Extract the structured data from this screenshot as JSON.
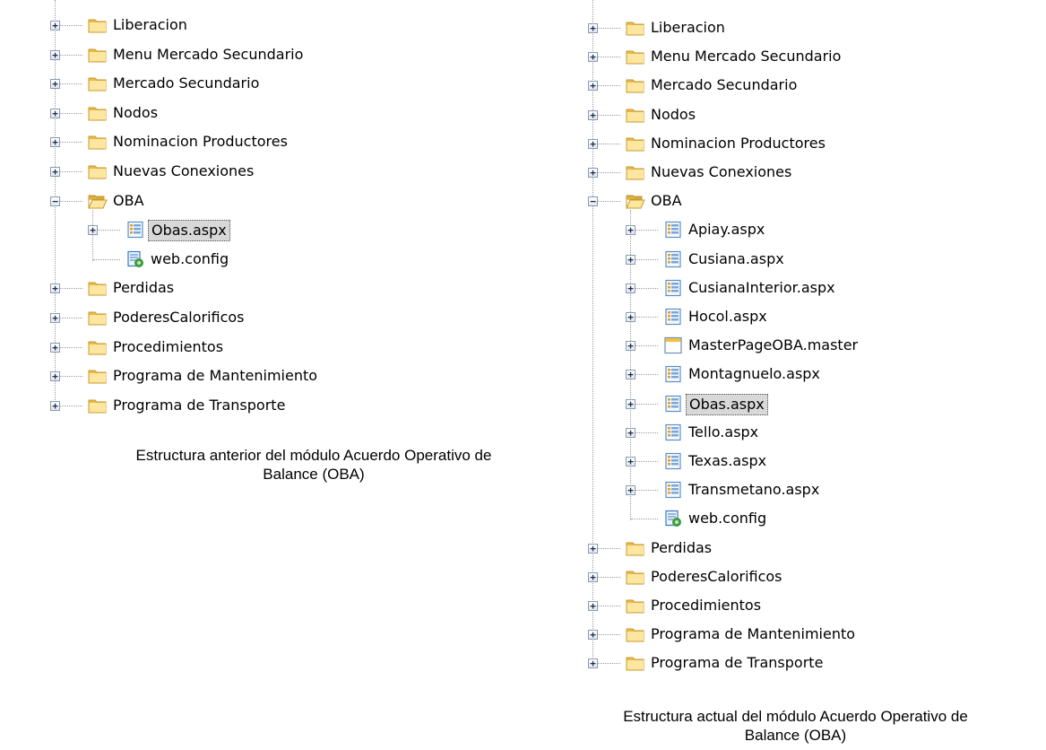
{
  "left_tree": {
    "nodes": [
      {
        "label": "Liberacion",
        "type": "folder",
        "expand": "+",
        "depth": 0
      },
      {
        "label": "Menu Mercado Secundario",
        "type": "folder",
        "expand": "+",
        "depth": 0
      },
      {
        "label": "Mercado Secundario",
        "type": "folder",
        "expand": "+",
        "depth": 0
      },
      {
        "label": "Nodos",
        "type": "folder",
        "expand": "+",
        "depth": 0
      },
      {
        "label": "Nominacion Productores",
        "type": "folder",
        "expand": "+",
        "depth": 0
      },
      {
        "label": "Nuevas Conexiones",
        "type": "folder",
        "expand": "+",
        "depth": 0
      },
      {
        "label": "OBA",
        "type": "folder-open",
        "expand": "-",
        "depth": 0
      },
      {
        "label": "Obas.aspx",
        "type": "aspx",
        "expand": "+",
        "depth": 1,
        "selected": true
      },
      {
        "label": "web.config",
        "type": "config",
        "expand": "",
        "depth": 1
      },
      {
        "label": "Perdidas",
        "type": "folder",
        "expand": "+",
        "depth": 0
      },
      {
        "label": "PoderesCalorificos",
        "type": "folder",
        "expand": "+",
        "depth": 0
      },
      {
        "label": "Procedimientos",
        "type": "folder",
        "expand": "+",
        "depth": 0
      },
      {
        "label": "Programa de Mantenimiento",
        "type": "folder",
        "expand": "+",
        "depth": 0
      },
      {
        "label": "Programa de Transporte",
        "type": "folder",
        "expand": "+",
        "depth": 0
      }
    ],
    "caption_line1": "Estructura anterior del módulo Acuerdo Operativo de",
    "caption_line2": "Balance (OBA)"
  },
  "right_tree": {
    "nodes": [
      {
        "label": "Liberacion",
        "type": "folder",
        "expand": "+",
        "depth": 0
      },
      {
        "label": "Menu Mercado Secundario",
        "type": "folder",
        "expand": "+",
        "depth": 0
      },
      {
        "label": "Mercado Secundario",
        "type": "folder",
        "expand": "+",
        "depth": 0
      },
      {
        "label": "Nodos",
        "type": "folder",
        "expand": "+",
        "depth": 0
      },
      {
        "label": "Nominacion Productores",
        "type": "folder",
        "expand": "+",
        "depth": 0
      },
      {
        "label": "Nuevas Conexiones",
        "type": "folder",
        "expand": "+",
        "depth": 0
      },
      {
        "label": "OBA",
        "type": "folder-open",
        "expand": "-",
        "depth": 0
      },
      {
        "label": "Apiay.aspx",
        "type": "aspx",
        "expand": "+",
        "depth": 1
      },
      {
        "label": "Cusiana.aspx",
        "type": "aspx",
        "expand": "+",
        "depth": 1
      },
      {
        "label": "CusianaInterior.aspx",
        "type": "aspx",
        "expand": "+",
        "depth": 1
      },
      {
        "label": "Hocol.aspx",
        "type": "aspx",
        "expand": "+",
        "depth": 1
      },
      {
        "label": "MasterPageOBA.master",
        "type": "master",
        "expand": "+",
        "depth": 1
      },
      {
        "label": "Montagnuelo.aspx",
        "type": "aspx",
        "expand": "+",
        "depth": 1
      },
      {
        "label": "Obas.aspx",
        "type": "aspx",
        "expand": "+",
        "depth": 1,
        "selected": true
      },
      {
        "label": "Tello.aspx",
        "type": "aspx",
        "expand": "+",
        "depth": 1
      },
      {
        "label": "Texas.aspx",
        "type": "aspx",
        "expand": "+",
        "depth": 1
      },
      {
        "label": "Transmetano.aspx",
        "type": "aspx",
        "expand": "+",
        "depth": 1
      },
      {
        "label": "web.config",
        "type": "config",
        "expand": "",
        "depth": 1
      },
      {
        "label": "Perdidas",
        "type": "folder",
        "expand": "+",
        "depth": 0
      },
      {
        "label": "PoderesCalorificos",
        "type": "folder",
        "expand": "+",
        "depth": 0
      },
      {
        "label": "Procedimientos",
        "type": "folder",
        "expand": "+",
        "depth": 0
      },
      {
        "label": "Programa de Mantenimiento",
        "type": "folder",
        "expand": "+",
        "depth": 0
      },
      {
        "label": "Programa de Transporte",
        "type": "folder",
        "expand": "+",
        "depth": 0
      }
    ],
    "caption_line1": "Estructura actual del módulo Acuerdo Operativo de",
    "caption_line2": "Balance (OBA)"
  },
  "colors": {
    "folder_light": "#fde7a0",
    "folder_dark": "#e8b84a",
    "folder_edge": "#c89a2c",
    "aspx_border": "#5a8fc8",
    "config_blue": "#3a78c8",
    "config_green": "#3a9a3a",
    "selected_bg": "#d8d8d8"
  }
}
